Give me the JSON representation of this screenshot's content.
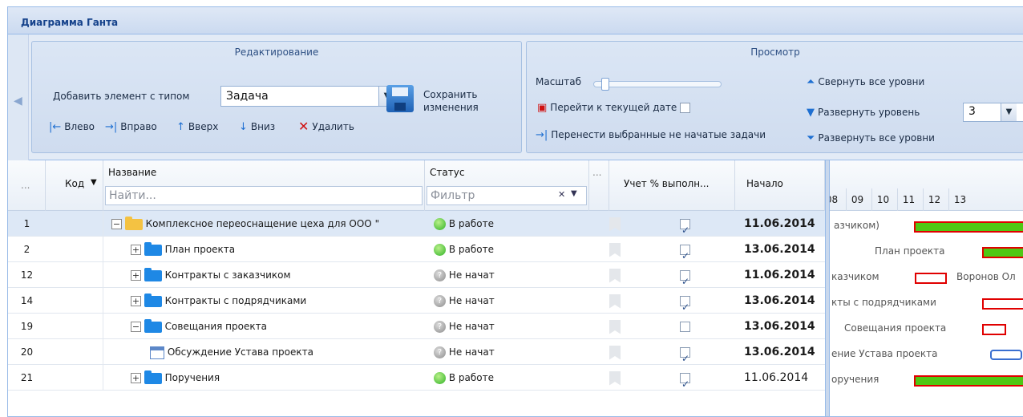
{
  "panel": {
    "title": "Диаграмма Ганта"
  },
  "ribbon": {
    "edit": {
      "title": "Редактирование",
      "add_label": "Добавить элемент с типом",
      "type_value": "Задача",
      "left": "Влево",
      "right": "Вправо",
      "up": "Вверх",
      "down": "Вниз",
      "delete": "Удалить",
      "save_line1": "Сохранить",
      "save_line2": "изменения"
    },
    "view": {
      "title": "Просмотр",
      "scale": "Масштаб",
      "scale_level": 0.06,
      "goto_today": "Перейти к текущей дате",
      "goto_today_checked": false,
      "move_tasks": "Перенести выбранные не начатые задачи",
      "collapse_all": "Свернуть все уровни",
      "expand_level": "Развернуть уровень",
      "expand_level_value": "3",
      "expand_all": "Развернуть все уровни"
    }
  },
  "grid": {
    "columns": {
      "dots": "...",
      "code": "Код",
      "name": "Название",
      "name_placeholder": "Найти...",
      "status": "Статус",
      "status_placeholder": "Фильтр",
      "dots2": "...",
      "progress": "Учет % выполн...",
      "start": "Начало"
    },
    "rows": [
      {
        "num": "1",
        "name": "Комплексное переоснащение цеха для ООО \"",
        "status": "В работе",
        "checked": true,
        "start": "11.06.2014"
      },
      {
        "num": "2",
        "name": "План проекта",
        "status": "В работе",
        "checked": true,
        "start": "13.06.2014"
      },
      {
        "num": "12",
        "name": "Контракты с заказчиком",
        "status": "Не начат",
        "checked": true,
        "start": "11.06.2014"
      },
      {
        "num": "14",
        "name": "Контракты с подрядчиками",
        "status": "Не начат",
        "checked": true,
        "start": "13.06.2014"
      },
      {
        "num": "19",
        "name": "Совещания проекта",
        "status": "Не начат",
        "checked": false,
        "start": "13.06.2014"
      },
      {
        "num": "20",
        "name": "Обсуждение Устава проекта",
        "status": "Не начат",
        "checked": true,
        "start": "13.06.2014"
      },
      {
        "num": "21",
        "name": "Поручения",
        "status": "В работе",
        "checked": true,
        "start": "11.06.2014"
      }
    ]
  },
  "gantt": {
    "days": [
      "08",
      "09",
      "10",
      "11",
      "12",
      "13"
    ],
    "labels": [
      "азчиком)",
      "План проекта",
      "казчиком",
      "Воронов Ол",
      "кты с подрядчиками",
      "Совещания проекта",
      "ение Устава проекта",
      "оручения"
    ],
    "colors": {
      "progress": "#4fc814",
      "summary": "#e8f4d4",
      "outline": "#e00000",
      "task": "#3a6fd0"
    }
  }
}
